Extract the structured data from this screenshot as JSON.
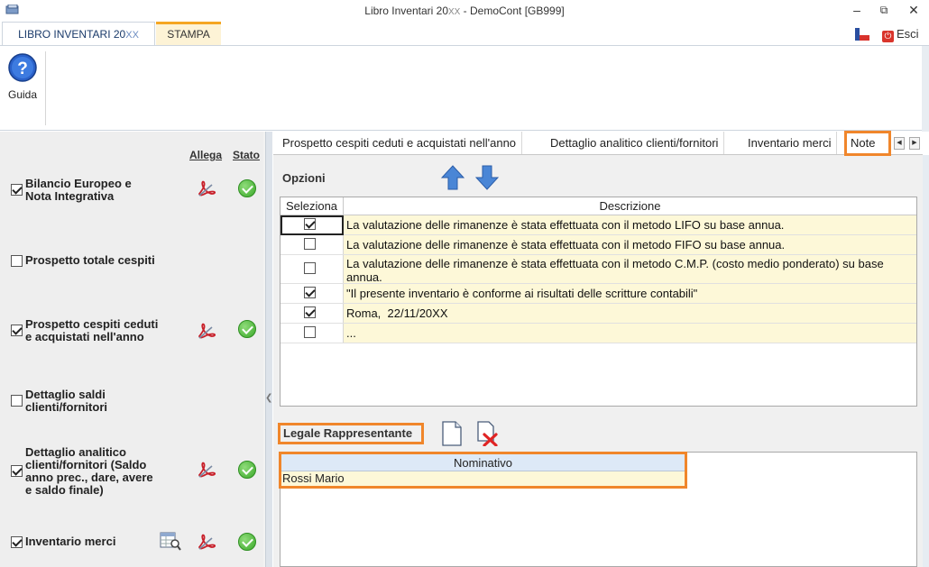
{
  "window": {
    "title_main": "Libro Inventari 20",
    "title_xx": "XX",
    "title_rest": " - DemoCont [GB999]"
  },
  "ribbon": {
    "tab_active_main": "LIBRO INVENTARI 20",
    "tab_active_xx": "XX",
    "tab_stampa": "STAMPA",
    "guida_label": "Guida",
    "esci_label": "Esci"
  },
  "left_panel": {
    "header_allega": "Allega",
    "header_stato": "Stato",
    "items": [
      {
        "label_lines": [
          "Bilancio Europeo e",
          "Nota Integrativa"
        ],
        "checked": true,
        "pdf": true,
        "ok": true,
        "table": false
      },
      {
        "label_lines": [
          "Prospetto totale cespiti"
        ],
        "checked": false,
        "pdf": false,
        "ok": false,
        "table": false
      },
      {
        "label_lines": [
          "Prospetto cespiti ceduti",
          "e acquistati nell'anno"
        ],
        "checked": true,
        "pdf": true,
        "ok": true,
        "table": false
      },
      {
        "label_lines": [
          "Dettaglio saldi",
          "clienti/fornitori"
        ],
        "checked": false,
        "pdf": false,
        "ok": false,
        "table": false
      },
      {
        "label_lines": [
          "Dettaglio analitico",
          "clienti/fornitori (Saldo",
          "anno prec., dare, avere",
          "e saldo finale)"
        ],
        "checked": true,
        "pdf": true,
        "ok": true,
        "table": false
      },
      {
        "label_lines": [
          "Inventario merci"
        ],
        "checked": true,
        "pdf": true,
        "ok": true,
        "table": true
      }
    ]
  },
  "content_tabs": [
    "Prospetto cespiti ceduti e acquistati nell'anno",
    "Dettaglio analitico clienti/fornitori",
    "Inventario merci",
    "Note"
  ],
  "options": {
    "title": "Opzioni",
    "col_seleziona": "Seleziona",
    "col_descrizione": "Descrizione",
    "rows": [
      {
        "checked": true,
        "text": "La valutazione delle rimanenze è stata effettuata con il metodo LIFO su base annua."
      },
      {
        "checked": false,
        "text": "La valutazione delle rimanenze è stata effettuata con il metodo FIFO su base annua."
      },
      {
        "checked": false,
        "text": "La valutazione delle rimanenze è stata effettuata con il metodo C.M.P. (costo medio ponderato) su base annua."
      },
      {
        "checked": true,
        "text": "\"Il presente inventario è conforme ai risultati delle scritture contabili\""
      },
      {
        "checked": true,
        "text": "Roma,  22/11/20XX"
      },
      {
        "checked": false,
        "text": "..."
      }
    ]
  },
  "legale": {
    "title": "Legale Rappresentante",
    "col_nominativo": "Nominativo",
    "rows": [
      "Rossi Mario"
    ]
  },
  "colors": {
    "highlight": "#f0862b",
    "row_bg": "#fdf8d8",
    "ok_green": "#3aa829"
  }
}
